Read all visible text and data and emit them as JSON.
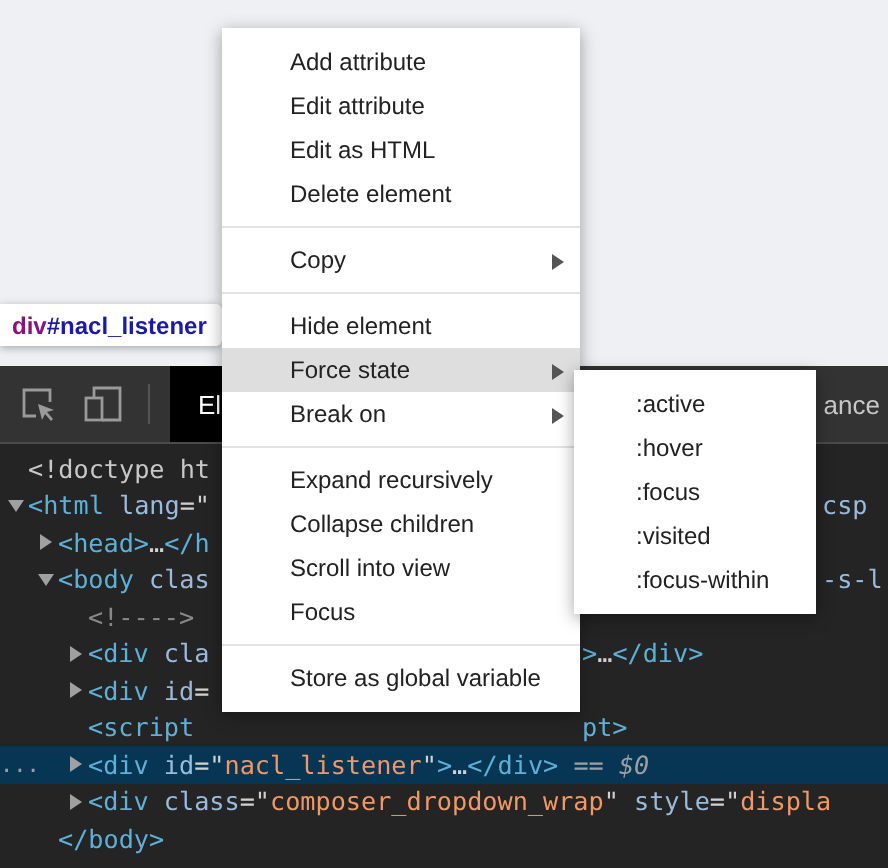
{
  "tooltip": {
    "tag": "div",
    "id": "#nacl_listener"
  },
  "toolbar": {
    "tabs": [
      {
        "label": "El",
        "selected": true
      },
      {
        "label": "ance",
        "selected": false
      }
    ]
  },
  "nodes": [
    {
      "selected": false,
      "tokens": [
        {
          "kind": "doctype",
          "t": "<!doctype ht"
        }
      ]
    },
    {
      "selected": false,
      "expanded": true,
      "tokens": [
        {
          "kind": "tag",
          "t": "<html"
        },
        {
          "kind": "attr",
          "t": " lang"
        },
        {
          "kind": "punct",
          "t": "=\""
        }
      ],
      "tail": [
        {
          "kind": "attr",
          "t": "csp"
        }
      ],
      "children": [
        {
          "selected": false,
          "expanded": false,
          "tokens": [
            {
              "kind": "tag",
              "t": "<head>"
            },
            {
              "kind": "punct",
              "t": "…"
            },
            {
              "kind": "tag",
              "t": "</h"
            }
          ]
        },
        {
          "selected": false,
          "expanded": true,
          "tokens": [
            {
              "kind": "tag",
              "t": "<body"
            },
            {
              "kind": "attr",
              "t": " clas"
            }
          ],
          "tail": [
            {
              "kind": "attr",
              "t": "-s-l"
            }
          ],
          "closing": [
            {
              "kind": "tag",
              "t": "</body>"
            }
          ],
          "children": [
            {
              "selected": false,
              "tokens": [
                {
                  "kind": "comment",
                  "t": "<!---->"
                }
              ]
            },
            {
              "selected": false,
              "expanded": false,
              "tokens": [
                {
                  "kind": "tag",
                  "t": "<div"
                },
                {
                  "kind": "attr",
                  "t": " cla"
                }
              ],
              "tail": [
                {
                  "kind": "tag",
                  "t": ">"
                },
                {
                  "kind": "punct",
                  "t": "…"
                },
                {
                  "kind": "tag",
                  "t": "</div>"
                }
              ]
            },
            {
              "selected": false,
              "expanded": false,
              "tokens": [
                {
                  "kind": "tag",
                  "t": "<div"
                },
                {
                  "kind": "attr",
                  "t": " id"
                },
                {
                  "kind": "punct",
                  "t": "="
                }
              ]
            },
            {
              "selected": false,
              "tokens": [
                {
                  "kind": "tag",
                  "t": "<script"
                }
              ],
              "tail": [
                {
                  "kind": "tag",
                  "t": "pt>"
                }
              ]
            },
            {
              "selected": true,
              "gutter": "...",
              "expanded": false,
              "tokens": [
                {
                  "kind": "tag",
                  "t": "<div"
                },
                {
                  "kind": "attr",
                  "t": " id"
                },
                {
                  "kind": "punct",
                  "t": "=\""
                },
                {
                  "kind": "value",
                  "t": "nacl_listener"
                },
                {
                  "kind": "punct",
                  "t": "\""
                },
                {
                  "kind": "tag",
                  "t": ">"
                },
                {
                  "kind": "punct",
                  "t": "…"
                },
                {
                  "kind": "tag",
                  "t": "</div>"
                },
                {
                  "kind": "ref",
                  "t": " == $0"
                }
              ]
            },
            {
              "selected": false,
              "expanded": false,
              "tokens": [
                {
                  "kind": "tag",
                  "t": "<div"
                },
                {
                  "kind": "attr",
                  "t": " class"
                },
                {
                  "kind": "punct",
                  "t": "=\""
                },
                {
                  "kind": "value",
                  "t": "composer_dropdown_wrap"
                },
                {
                  "kind": "punct",
                  "t": "\""
                },
                {
                  "kind": "attr",
                  "t": " style"
                },
                {
                  "kind": "punct",
                  "t": "=\""
                },
                {
                  "kind": "value",
                  "t": "displa"
                }
              ]
            }
          ]
        }
      ]
    }
  ],
  "menu": {
    "groups": [
      {
        "items": [
          {
            "label": "Add attribute",
            "selected": false
          },
          {
            "label": "Edit attribute",
            "selected": false
          },
          {
            "label": "Edit as HTML",
            "selected": false
          },
          {
            "label": "Delete element",
            "selected": false
          }
        ]
      },
      {
        "items": [
          {
            "label": "Copy",
            "selected": false,
            "submenu": true
          }
        ]
      },
      {
        "items": [
          {
            "label": "Hide element",
            "selected": false
          },
          {
            "label": "Force state",
            "selected": true,
            "submenu": true
          },
          {
            "label": "Break on",
            "selected": false,
            "submenu": true
          }
        ]
      },
      {
        "items": [
          {
            "label": "Expand recursively",
            "selected": false
          },
          {
            "label": "Collapse children",
            "selected": false
          },
          {
            "label": "Scroll into view",
            "selected": false
          },
          {
            "label": "Focus",
            "selected": false
          }
        ]
      },
      {
        "items": [
          {
            "label": "Store as global variable",
            "selected": false
          }
        ]
      }
    ]
  },
  "submenu": {
    "items": [
      {
        "label": ":active",
        "selected": false
      },
      {
        "label": ":hover",
        "selected": false
      },
      {
        "label": ":focus",
        "selected": false
      },
      {
        "label": ":visited",
        "selected": false
      },
      {
        "label": ":focus-within",
        "selected": false
      }
    ]
  }
}
